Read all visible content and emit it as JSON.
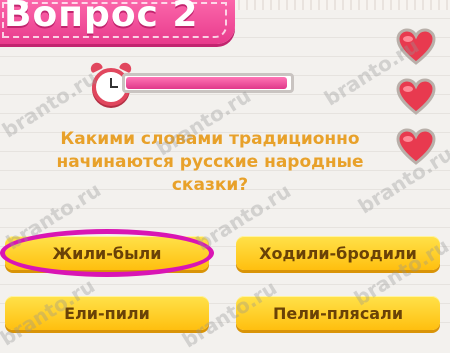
{
  "header": {
    "title": "Вопрос 2"
  },
  "timer": {
    "progress": 0.98
  },
  "lives": {
    "count": 3
  },
  "question": {
    "text": "Какими словами традиционно начинаются русские народные сказки?"
  },
  "answers": [
    {
      "label": "Жили-были",
      "highlighted": true
    },
    {
      "label": "Ходили-бродили",
      "highlighted": false
    },
    {
      "label": "Ели-пили",
      "highlighted": false
    },
    {
      "label": "Пели-плясали",
      "highlighted": false
    }
  ],
  "watermark": {
    "text": "branto.ru"
  },
  "colors": {
    "banner": "#e83b8c",
    "question": "#e8a12a",
    "answer": "#ffd21f",
    "highlight": "#d915b4",
    "heart": "#e83a4f"
  }
}
